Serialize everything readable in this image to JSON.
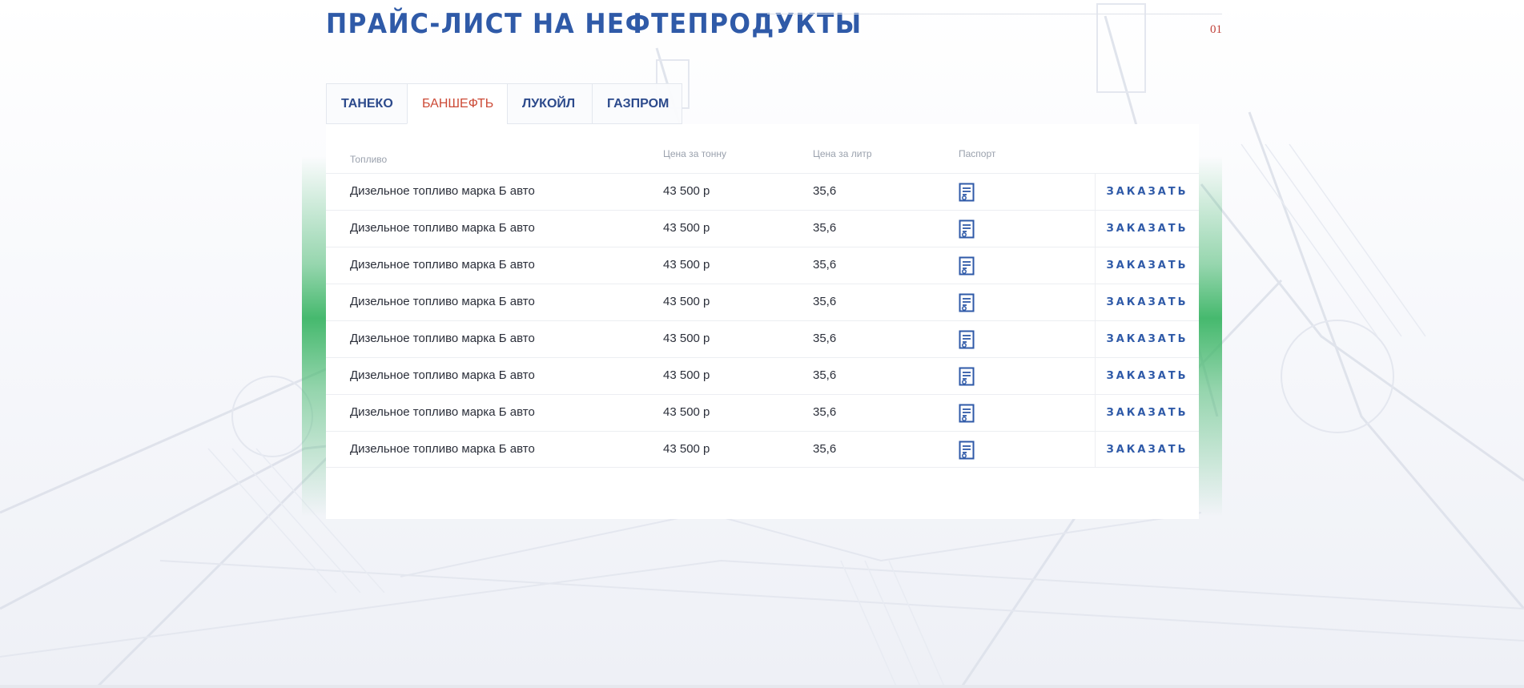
{
  "page": {
    "title": "ПРАЙС-ЛИСТ НА НЕФТЕПРОДУКТЫ",
    "section_number": "01"
  },
  "tabs": [
    {
      "label": "ТАНЕКО",
      "active": false
    },
    {
      "label": "БАНШЕФТЬ",
      "active": true
    },
    {
      "label": "ЛУКОЙЛ",
      "active": false
    },
    {
      "label": "ГАЗПРОМ",
      "active": false
    }
  ],
  "table": {
    "headers": {
      "fuel": "Топливо",
      "price_ton": "Цена за тонну",
      "price_liter": "Цена за литр",
      "passport": "Паспорт"
    },
    "rows": [
      {
        "fuel": "Дизельное топливо марка Б авто",
        "price_ton": "43 500 р",
        "price_liter": "35,6",
        "passport_icon": "document-icon",
        "order": "ЗАКАЗАТЬ"
      },
      {
        "fuel": "Дизельное топливо марка Б авто",
        "price_ton": "43 500 р",
        "price_liter": "35,6",
        "passport_icon": "document-icon",
        "order": "ЗАКАЗАТЬ"
      },
      {
        "fuel": "Дизельное топливо марка Б авто",
        "price_ton": "43 500 р",
        "price_liter": "35,6",
        "passport_icon": "document-icon",
        "order": "ЗАКАЗАТЬ"
      },
      {
        "fuel": "Дизельное топливо марка Б авто",
        "price_ton": "43 500 р",
        "price_liter": "35,6",
        "passport_icon": "document-icon",
        "order": "ЗАКАЗАТЬ"
      },
      {
        "fuel": "Дизельное топливо марка Б авто",
        "price_ton": "43 500 р",
        "price_liter": "35,6",
        "passport_icon": "document-icon",
        "order": "ЗАКАЗАТЬ"
      },
      {
        "fuel": "Дизельное топливо марка Б авто",
        "price_ton": "43 500 р",
        "price_liter": "35,6",
        "passport_icon": "document-icon",
        "order": "ЗАКАЗАТЬ"
      },
      {
        "fuel": "Дизельное топливо марка Б авто",
        "price_ton": "43 500 р",
        "price_liter": "35,6",
        "passport_icon": "document-icon",
        "order": "ЗАКАЗАТЬ"
      },
      {
        "fuel": "Дизельное топливо марка Б авто",
        "price_ton": "43 500 р",
        "price_liter": "35,6",
        "passport_icon": "document-icon",
        "order": "ЗАКАЗАТЬ"
      }
    ]
  },
  "colors": {
    "title": "#2f5aa8",
    "active_tab": "#cc4a36",
    "tab": "#2c4a8c",
    "accent_green": "#46b96e",
    "section_number": "#c0413a"
  }
}
